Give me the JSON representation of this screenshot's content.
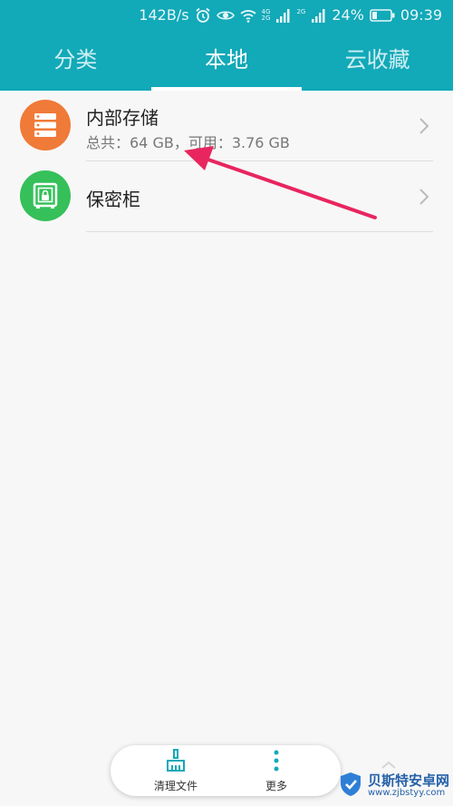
{
  "status_bar": {
    "net_speed": "142B/s",
    "net_gen_1_top": "4G",
    "net_gen_1_bottom": "2G",
    "net_gen_2": "2G",
    "battery_percent": "24%",
    "time": "09:39",
    "icons": [
      "alarm-icon",
      "eye-icon",
      "wifi-icon",
      "signal-icon",
      "signal-icon",
      "battery-icon"
    ]
  },
  "tabs": [
    {
      "label": "分类",
      "active": false
    },
    {
      "label": "本地",
      "active": true
    },
    {
      "label": "云收藏",
      "active": false
    }
  ],
  "list": [
    {
      "title": "内部存储",
      "subtitle": "总共：64 GB，可用：3.76 GB",
      "icon": "storage-icon",
      "color": "#f07a38"
    },
    {
      "title": "保密柜",
      "icon": "safe-icon",
      "color": "#35c05a"
    }
  ],
  "bottom_bar": {
    "clean_label": "清理文件",
    "more_label": "更多",
    "clean_icon": "broom-icon",
    "more_icon": "more-vertical-icon"
  },
  "watermark": {
    "name": "贝斯特安卓网",
    "url": "www.zjbstyy.com",
    "icon": "shield-logo-icon"
  },
  "colors": {
    "header": "#12a9b8",
    "arrow": "#e8255f",
    "background": "#f7f7f7"
  }
}
